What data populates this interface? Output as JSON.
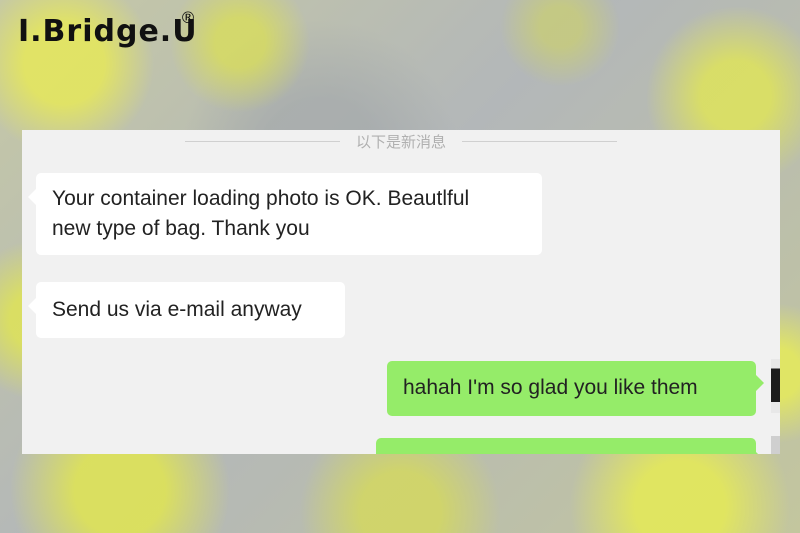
{
  "brand": {
    "name": "I.Bridge.U",
    "registered_mark": "®"
  },
  "chat": {
    "divider_text": "以下是新消息",
    "messages": [
      {
        "direction": "incoming",
        "lines": [
          "Your container loading photo is OK. Beautlful",
          "new type of bag. Thank you"
        ]
      },
      {
        "direction": "incoming",
        "lines": [
          "Send us via e-mail anyway"
        ]
      },
      {
        "direction": "outgoing",
        "lines": [
          "hahah I'm so glad you like them"
        ]
      },
      {
        "direction": "outgoing",
        "lines": [
          ""
        ]
      }
    ]
  },
  "colors": {
    "incoming_bubble": "#ffffff",
    "outgoing_bubble": "#95ec69",
    "chat_background": "#f1f1f1",
    "brand_text": "#111111"
  }
}
